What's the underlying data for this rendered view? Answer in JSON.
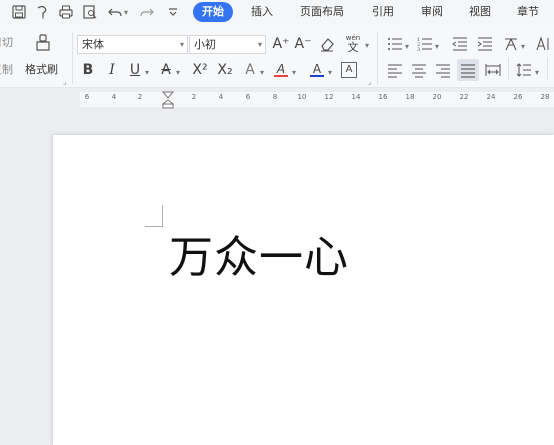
{
  "tabs": [
    {
      "label": "开始",
      "active": true
    },
    {
      "label": "插入"
    },
    {
      "label": "页面布局"
    },
    {
      "label": "引用"
    },
    {
      "label": "审阅"
    },
    {
      "label": "视图"
    },
    {
      "label": "章节"
    }
  ],
  "quick_access": [
    "save-icon",
    "history-icon",
    "print-icon",
    "print-preview-icon",
    "undo-icon",
    "redo-icon",
    "customize-icon"
  ],
  "ribbon": {
    "cut_label": "剪切",
    "copy_label": "复制",
    "format_painter_label": "格式刷",
    "font_name": "宋体",
    "font_size": "小初",
    "bold": "B",
    "italic": "I",
    "underline": "U",
    "strikethrough": "A",
    "superscript": "X²",
    "subscript": "X₂",
    "text_effect": "A",
    "highlight": "A",
    "font_color": "A",
    "char_border": "A",
    "grow_font": "A⁺",
    "shrink_font": "A⁻",
    "pinyin": "wén",
    "pinyin_char": "文"
  },
  "ruler": {
    "ticks": [
      "6",
      "4",
      "2",
      "2",
      "4",
      "6",
      "8",
      "10",
      "12",
      "14",
      "16",
      "18",
      "20",
      "22",
      "24",
      "26",
      "28"
    ]
  },
  "document": {
    "text": "万众一心"
  },
  "colors": {
    "accent": "#3574f0",
    "font_color_bar": "#1f3fd1",
    "highlight_bar": "#e64545"
  }
}
